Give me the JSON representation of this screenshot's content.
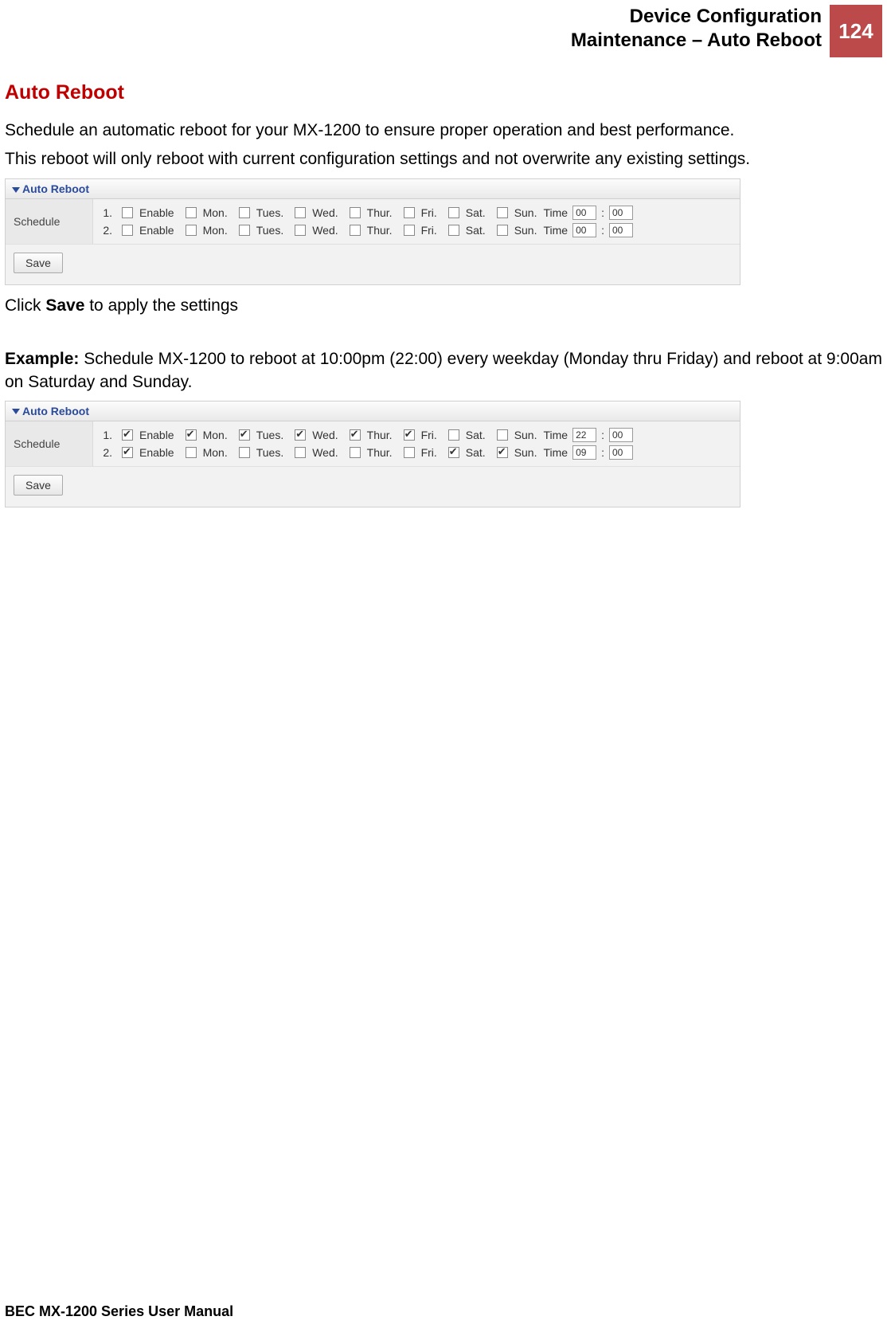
{
  "header": {
    "line1": "Device Configuration",
    "line2": "Maintenance – Auto Reboot",
    "page_number": "124"
  },
  "section_title": "Auto Reboot",
  "intro1": "Schedule an automatic reboot for your MX-1200 to ensure proper operation and best performance.",
  "intro2": "This reboot will only reboot with current configuration settings and not overwrite any existing settings.",
  "panel_title": "Auto Reboot",
  "schedule_label": "Schedule",
  "row_labels": {
    "idx1": "1.",
    "idx2": "2.",
    "enable": "Enable",
    "mon": "Mon.",
    "tue": "Tues.",
    "wed": "Wed.",
    "thu": "Thur.",
    "fri": "Fri.",
    "sat": "Sat.",
    "sun": "Sun.",
    "time": "Time",
    "colon": ":"
  },
  "panel1": {
    "row1": {
      "enable": false,
      "mon": false,
      "tue": false,
      "wed": false,
      "thu": false,
      "fri": false,
      "sat": false,
      "sun": false,
      "hh": "00",
      "mm": "00"
    },
    "row2": {
      "enable": false,
      "mon": false,
      "tue": false,
      "wed": false,
      "thu": false,
      "fri": false,
      "sat": false,
      "sun": false,
      "hh": "00",
      "mm": "00"
    }
  },
  "save_label": "Save",
  "click_save_pre": "Click ",
  "click_save_bold": "Save",
  "click_save_post": " to apply the settings",
  "example_bold": "Example:",
  "example_text": " Schedule MX-1200 to reboot at 10:00pm (22:00) every weekday (Monday thru Friday) and reboot at 9:00am on Saturday and Sunday.",
  "panel2": {
    "row1": {
      "enable": true,
      "mon": true,
      "tue": true,
      "wed": true,
      "thu": true,
      "fri": true,
      "sat": false,
      "sun": false,
      "hh": "22",
      "mm": "00"
    },
    "row2": {
      "enable": true,
      "mon": false,
      "tue": false,
      "wed": false,
      "thu": false,
      "fri": false,
      "sat": true,
      "sun": true,
      "hh": "09",
      "mm": "00"
    }
  },
  "footer": "BEC MX-1200 Series User Manual"
}
